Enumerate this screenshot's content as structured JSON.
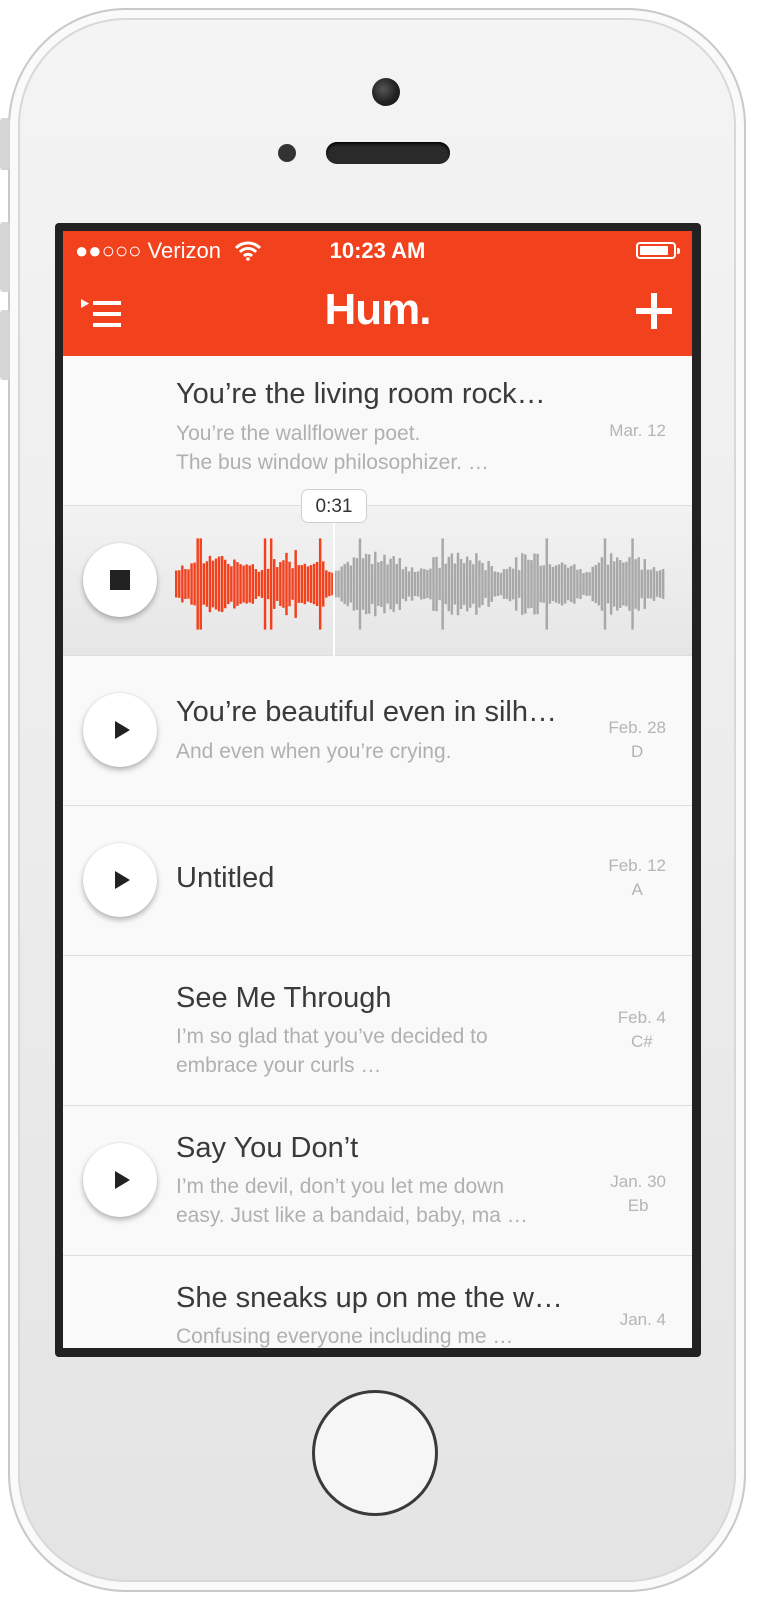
{
  "status_bar": {
    "carrier": "●●○○○ Verizon",
    "time": "10:23 AM",
    "wifi_icon": "wifi-icon",
    "battery_icon": "battery-icon"
  },
  "nav": {
    "logo": "Hum.",
    "menu_icon": "menu-list-icon",
    "add_icon": "plus-icon",
    "accent_color": "#f2411d"
  },
  "player": {
    "elapsed": "0:31",
    "progress_fraction": 0.32,
    "played_color": "#f2411d",
    "remaining_color": "#a8a8a8",
    "stop_icon": "stop-icon"
  },
  "songs": [
    {
      "title": "You’re the living room rock…",
      "lines": [
        "You’re the wallflower poet.",
        "The bus window philosophizer. …"
      ],
      "date": "Mar. 12",
      "key": ""
    },
    {
      "title": "You’re beautiful even in silh…",
      "lines": [
        "And even when you’re crying."
      ],
      "date": "Feb. 28",
      "key": "D"
    },
    {
      "title": "Untitled",
      "lines": [],
      "date": "Feb. 12",
      "key": "A"
    },
    {
      "title": "See Me Through",
      "lines": [
        "I’m so glad that you’ve decided to",
        "embrace your curls …"
      ],
      "date": "Feb. 4",
      "key": "C#"
    },
    {
      "title": "Say You Don’t",
      "lines": [
        "I’m the devil, don’t you let me down",
        "easy. Just like a bandaid, baby, ma …"
      ],
      "date": "Jan. 30",
      "key": "Eb"
    },
    {
      "title": "She sneaks up on me the w…",
      "lines": [
        "Confusing everyone including me …"
      ],
      "date": "Jan. 4",
      "key": ""
    }
  ]
}
